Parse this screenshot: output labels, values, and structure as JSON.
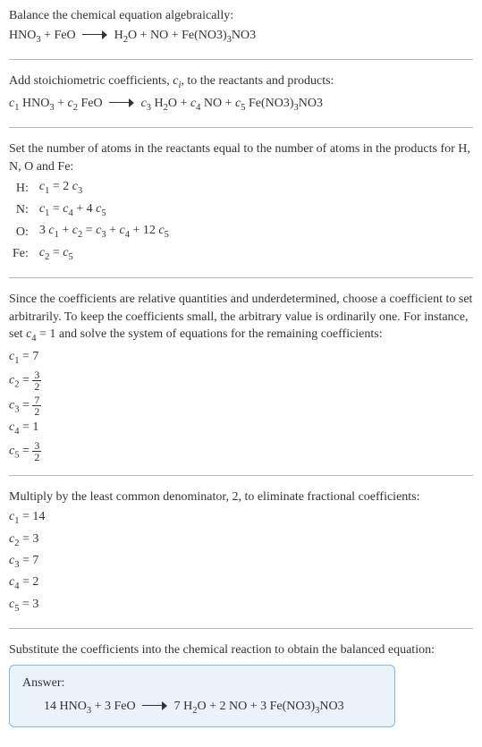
{
  "intro": {
    "line1_pre": "Balance the chemical equation algebraically:",
    "eq_left": "HNO",
    "eq_left_sub": "3",
    "eq_left2": " + FeO",
    "eq_right1": "H",
    "eq_right1_sub": "2",
    "eq_right2": "O + NO + Fe(NO3)",
    "eq_right2_sub": "3",
    "eq_right3": "NO3"
  },
  "stoich": {
    "text_pre": "Add stoichiometric coefficients, ",
    "ci": "c",
    "ci_sub": "i",
    "text_post": ", to the reactants and products:",
    "c1": "c",
    "c1_sub": "1",
    "hno3_a": " HNO",
    "hno3_sub": "3",
    "plus1": " + ",
    "c2": "c",
    "c2_sub": "2",
    "feo": " FeO",
    "c3": "c",
    "c3_sub": "3",
    "h2o_a": " H",
    "h2o_sub": "2",
    "h2o_b": "O + ",
    "c4": "c",
    "c4_sub": "4",
    "no": " NO + ",
    "c5": "c",
    "c5_sub": "5",
    "fe_a": " Fe(NO3)",
    "fe_sub": "3",
    "fe_b": "NO3"
  },
  "atoms": {
    "intro": "Set the number of atoms in the reactants equal to the number of atoms in the products for H, N, O and Fe:",
    "rows": {
      "h_label": "H:",
      "h_eq_a": "c",
      "h_eq_a_sub": "1",
      "h_eq_b": " = 2 ",
      "h_eq_c": "c",
      "h_eq_c_sub": "3",
      "n_label": "N:",
      "n_eq_a": "c",
      "n_eq_a_sub": "1",
      "n_eq_b": " = ",
      "n_eq_c": "c",
      "n_eq_c_sub": "4",
      "n_eq_d": " + 4 ",
      "n_eq_e": "c",
      "n_eq_e_sub": "5",
      "o_label": "O:",
      "o_eq_a": "3 ",
      "o_eq_b": "c",
      "o_eq_b_sub": "1",
      "o_eq_c": " + ",
      "o_eq_d": "c",
      "o_eq_d_sub": "2",
      "o_eq_e": " = ",
      "o_eq_f": "c",
      "o_eq_f_sub": "3",
      "o_eq_g": " + ",
      "o_eq_h": "c",
      "o_eq_h_sub": "4",
      "o_eq_i": " + 12 ",
      "o_eq_j": "c",
      "o_eq_j_sub": "5",
      "fe_label": "Fe:",
      "fe_eq_a": "c",
      "fe_eq_a_sub": "2",
      "fe_eq_b": " = ",
      "fe_eq_c": "c",
      "fe_eq_c_sub": "5"
    }
  },
  "arbitrary": {
    "text_a": "Since the coefficients are relative quantities and underdetermined, choose a coefficient to set arbitrarily. To keep the coefficients small, the arbitrary value is ordinarily one. For instance, set ",
    "c4": "c",
    "c4_sub": "4",
    "text_b": " = 1 and solve the system of equations for the remaining coefficients:",
    "c1_lhs": "c",
    "c1_lhs_sub": "1",
    "c1_eq": " = 7",
    "c2_lhs": "c",
    "c2_lhs_sub": "2",
    "c2_eq": " = ",
    "c2_num": "3",
    "c2_den": "2",
    "c3_lhs": "c",
    "c3_lhs_sub": "3",
    "c3_eq": " = ",
    "c3_num": "7",
    "c3_den": "2",
    "c4r_lhs": "c",
    "c4r_lhs_sub": "4",
    "c4r_eq": " = 1",
    "c5_lhs": "c",
    "c5_lhs_sub": "5",
    "c5_eq": " = ",
    "c5_num": "3",
    "c5_den": "2"
  },
  "lcd": {
    "text": "Multiply by the least common denominator, 2, to eliminate fractional coefficients:",
    "c1_lhs": "c",
    "c1_lhs_sub": "1",
    "c1_eq": " = 14",
    "c2_lhs": "c",
    "c2_lhs_sub": "2",
    "c2_eq": " = 3",
    "c3_lhs": "c",
    "c3_lhs_sub": "3",
    "c3_eq": " = 7",
    "c4_lhs": "c",
    "c4_lhs_sub": "4",
    "c4_eq": " = 2",
    "c5_lhs": "c",
    "c5_lhs_sub": "5",
    "c5_eq": " = 3"
  },
  "final": {
    "text": "Substitute the coefficients into the chemical reaction to obtain the balanced equation:",
    "answer_label": "Answer:",
    "eq_a": "14 HNO",
    "eq_a_sub": "3",
    "eq_b": " + 3 FeO",
    "eq_c": "7 H",
    "eq_c_sub": "2",
    "eq_d": "O + 2 NO + 3 Fe(NO3)",
    "eq_d_sub": "3",
    "eq_e": "NO3"
  }
}
